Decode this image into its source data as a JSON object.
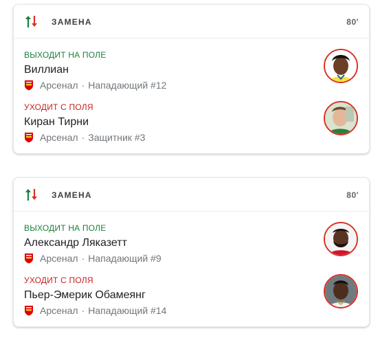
{
  "cards": [
    {
      "title": "ЗАМЕНА",
      "minute": "80'",
      "in": {
        "status": "ВЫХОДИТ НА ПОЛЕ",
        "name": "Виллиан",
        "team": "Арсенал",
        "sep": "·",
        "role": "Нападающий #12"
      },
      "out": {
        "status": "УХОДИТ С ПОЛЯ",
        "name": "Киран Тирни",
        "team": "Арсенал",
        "sep": "·",
        "role": "Защитник #3"
      }
    },
    {
      "title": "ЗАМЕНА",
      "minute": "80'",
      "in": {
        "status": "ВЫХОДИТ НА ПОЛЕ",
        "name": "Александр Ляказетт",
        "team": "Арсенал",
        "sep": "·",
        "role": "Нападающий #9"
      },
      "out": {
        "status": "УХОДИТ С ПОЛЯ",
        "name": "Пьер-Эмерик Обамеянг",
        "team": "Арсенал",
        "sep": "·",
        "role": "Нападающий #14"
      }
    }
  ],
  "colors": {
    "in": "#188038",
    "out": "#c5221f",
    "avatar_ring": "#d93025",
    "crest": "#db0007"
  },
  "icons": {
    "substitution": "substitution-arrows-icon",
    "team": "arsenal-crest-icon",
    "avatar": "player-photo"
  }
}
